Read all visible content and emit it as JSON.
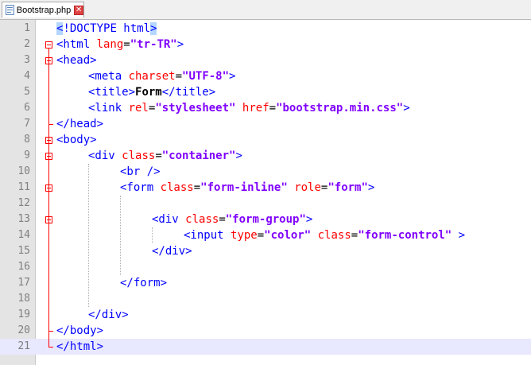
{
  "tab": {
    "filename": "Bootstrap.php",
    "close_symbol": "✕"
  },
  "editor": {
    "current_line": 21,
    "lines": [
      {
        "n": "1",
        "indent": 0,
        "tokens": [
          {
            "t": "tag-hl",
            "v": "<"
          },
          {
            "t": "tag",
            "v": "!DOCTYPE html"
          },
          {
            "t": "tag-hl",
            "v": ">"
          }
        ]
      },
      {
        "n": "2",
        "indent": 0,
        "tokens": [
          {
            "t": "tag",
            "v": "<html "
          },
          {
            "t": "attr",
            "v": "lang"
          },
          {
            "t": "plain",
            "v": "="
          },
          {
            "t": "str",
            "v": "\"tr-TR\""
          },
          {
            "t": "tag",
            "v": ">"
          }
        ]
      },
      {
        "n": "3",
        "indent": 0,
        "tokens": [
          {
            "t": "tag",
            "v": "<head>"
          }
        ]
      },
      {
        "n": "4",
        "indent": 1,
        "tokens": [
          {
            "t": "tag",
            "v": "<meta "
          },
          {
            "t": "attr",
            "v": "charset"
          },
          {
            "t": "plain",
            "v": "="
          },
          {
            "t": "str",
            "v": "\"UTF-8\""
          },
          {
            "t": "tag",
            "v": ">"
          }
        ]
      },
      {
        "n": "5",
        "indent": 1,
        "tokens": [
          {
            "t": "tag",
            "v": "<title>"
          },
          {
            "t": "txt",
            "v": "Form"
          },
          {
            "t": "tag",
            "v": "</title>"
          }
        ]
      },
      {
        "n": "6",
        "indent": 1,
        "tokens": [
          {
            "t": "tag",
            "v": "<link "
          },
          {
            "t": "attr",
            "v": "rel"
          },
          {
            "t": "plain",
            "v": "="
          },
          {
            "t": "str",
            "v": "\"stylesheet\""
          },
          {
            "t": "plain",
            "v": " "
          },
          {
            "t": "attr",
            "v": "href"
          },
          {
            "t": "plain",
            "v": "="
          },
          {
            "t": "str",
            "v": "\"bootstrap.min.css\""
          },
          {
            "t": "tag",
            "v": ">"
          }
        ]
      },
      {
        "n": "7",
        "indent": 0,
        "tokens": [
          {
            "t": "tag",
            "v": "</head>"
          }
        ]
      },
      {
        "n": "8",
        "indent": 0,
        "tokens": [
          {
            "t": "tag",
            "v": "<body>"
          }
        ]
      },
      {
        "n": "9",
        "indent": 1,
        "tokens": [
          {
            "t": "tag",
            "v": "<div "
          },
          {
            "t": "attr",
            "v": "class"
          },
          {
            "t": "plain",
            "v": "="
          },
          {
            "t": "str",
            "v": "\"container\""
          },
          {
            "t": "tag",
            "v": ">"
          }
        ]
      },
      {
        "n": "10",
        "indent": 2,
        "tokens": [
          {
            "t": "tag",
            "v": "<br />"
          }
        ]
      },
      {
        "n": "11",
        "indent": 2,
        "tokens": [
          {
            "t": "tag",
            "v": "<form "
          },
          {
            "t": "attr",
            "v": "class"
          },
          {
            "t": "plain",
            "v": "="
          },
          {
            "t": "str",
            "v": "\"form-inline\""
          },
          {
            "t": "plain",
            "v": " "
          },
          {
            "t": "attr",
            "v": "role"
          },
          {
            "t": "plain",
            "v": "="
          },
          {
            "t": "str",
            "v": "\"form\""
          },
          {
            "t": "tag",
            "v": ">"
          }
        ]
      },
      {
        "n": "12",
        "indent": 0,
        "tokens": []
      },
      {
        "n": "13",
        "indent": 3,
        "tokens": [
          {
            "t": "tag",
            "v": "<div "
          },
          {
            "t": "attr",
            "v": "class"
          },
          {
            "t": "plain",
            "v": "="
          },
          {
            "t": "str",
            "v": "\"form-group\""
          },
          {
            "t": "tag",
            "v": ">"
          }
        ]
      },
      {
        "n": "14",
        "indent": 4,
        "tokens": [
          {
            "t": "tag",
            "v": "<input "
          },
          {
            "t": "attr",
            "v": "type"
          },
          {
            "t": "plain",
            "v": "="
          },
          {
            "t": "str",
            "v": "\"color\""
          },
          {
            "t": "plain",
            "v": " "
          },
          {
            "t": "attr",
            "v": "class"
          },
          {
            "t": "plain",
            "v": "="
          },
          {
            "t": "str",
            "v": "\"form-control\""
          },
          {
            "t": "plain",
            "v": " "
          },
          {
            "t": "tag",
            "v": ">"
          }
        ]
      },
      {
        "n": "15",
        "indent": 3,
        "tokens": [
          {
            "t": "tag",
            "v": "</div>"
          }
        ]
      },
      {
        "n": "16",
        "indent": 0,
        "tokens": []
      },
      {
        "n": "17",
        "indent": 2,
        "tokens": [
          {
            "t": "tag",
            "v": "</form>"
          }
        ]
      },
      {
        "n": "18",
        "indent": 0,
        "tokens": []
      },
      {
        "n": "19",
        "indent": 1,
        "tokens": [
          {
            "t": "tag",
            "v": "</div>"
          }
        ]
      },
      {
        "n": "20",
        "indent": 0,
        "tokens": [
          {
            "t": "tag",
            "v": "</body>"
          }
        ]
      },
      {
        "n": "21",
        "indent": 0,
        "tokens": [
          {
            "t": "tag",
            "v": "</html>"
          }
        ]
      }
    ]
  },
  "colors": {
    "tag": "#0000ff",
    "attribute": "#ff0000",
    "string": "#8000ff",
    "fold_marker": "#ff0000",
    "current_line": "#e8e8ff",
    "gutter": "#e4e4e4"
  }
}
